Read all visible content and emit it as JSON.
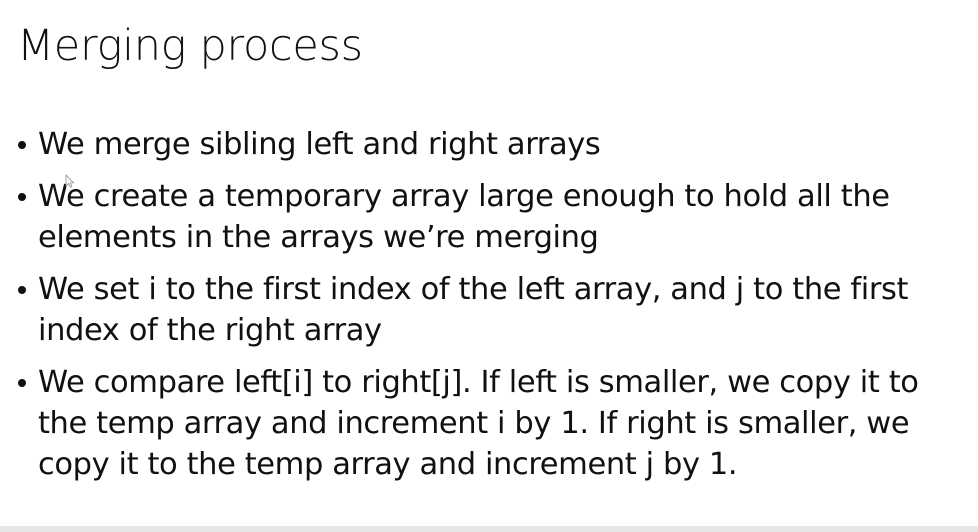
{
  "slide": {
    "title": "Merging process",
    "bullets": [
      "We merge sibling left and right arrays",
      "We create a temporary array large enough to hold all the elements in the arrays we’re merging",
      "We set i to the first index of the left array, and j to the first index of the right array",
      "We compare left[i] to right[j]. If left is smaller, we copy it to the temp array and increment i by 1. If right is smaller, we copy it to the temp array and increment j by 1."
    ]
  },
  "icons": {
    "cursor": "mouse-pointer-icon"
  }
}
